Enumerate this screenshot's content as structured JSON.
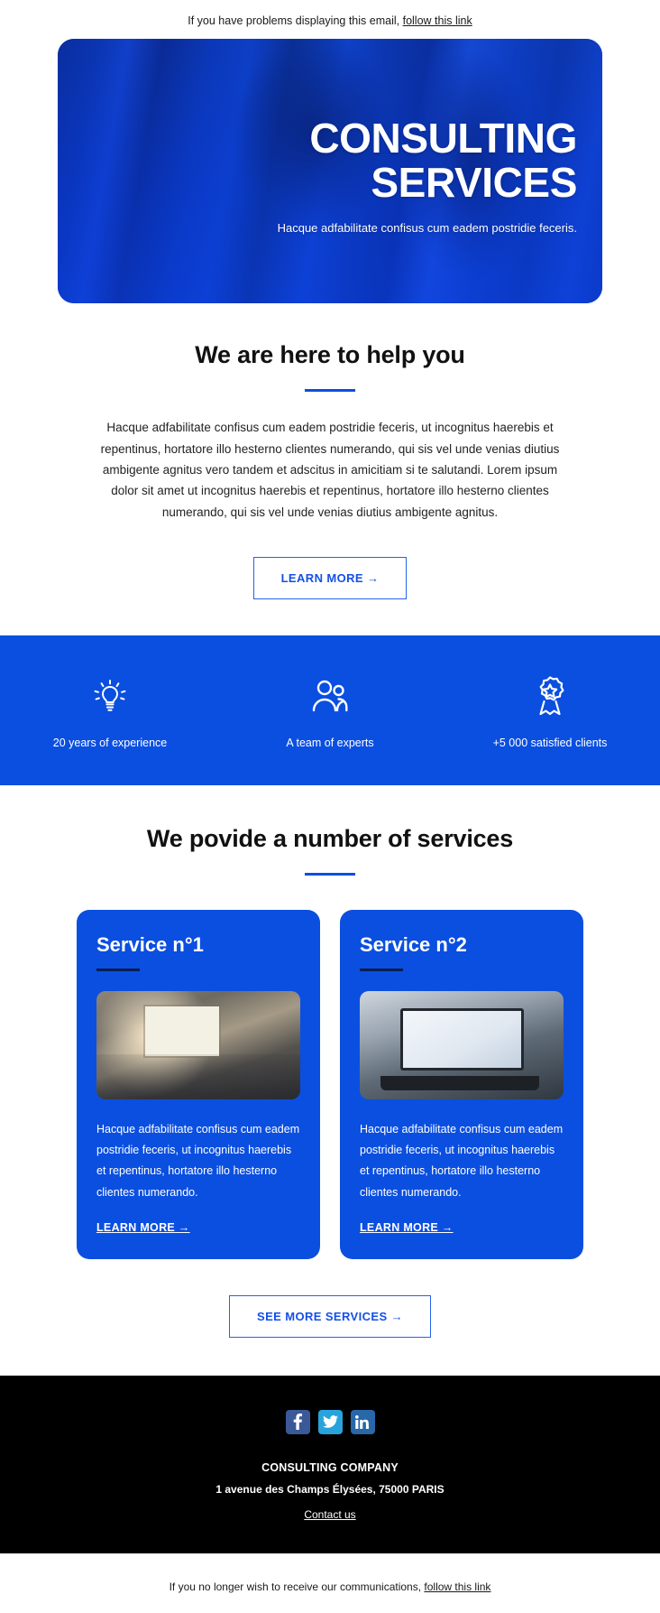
{
  "preheader": {
    "text": "If you have problems displaying this email,",
    "link": "follow this link"
  },
  "hero": {
    "title_line1": "CONSULTING",
    "title_line2": "SERVICES",
    "subtitle": "Hacque adfabilitate confisus cum eadem postridie feceris."
  },
  "intro": {
    "heading": "We are here to help you",
    "body": "Hacque adfabilitate confisus cum eadem postridie feceris, ut incognitus haerebis et repentinus, hortatore illo hesterno clientes numerando, qui sis vel unde venias diutius ambigente agnitus vero tandem et adscitus in amicitiam si te salutandi. Lorem ipsum dolor sit amet ut incognitus haerebis et repentinus, hortatore illo hesterno clientes numerando, qui sis vel unde venias diutius ambigente agnitus.",
    "cta": "LEARN MORE →"
  },
  "features": {
    "background_color": "#0b4fe0",
    "items": [
      {
        "icon": "lightbulb-icon",
        "label": "20 years of experience"
      },
      {
        "icon": "team-icon",
        "label": "A team of experts"
      },
      {
        "icon": "award-ribbon-icon",
        "label": "+5 000 satisfied clients"
      }
    ]
  },
  "services": {
    "heading": "We povide a number of services",
    "cards": [
      {
        "title": "Service n°1",
        "body": "Hacque adfabilitate confisus cum eadem postridie feceris, ut incognitus haerebis et repentinus, hortatore illo hesterno clientes numerando.",
        "link": "LEARN MORE →"
      },
      {
        "title": "Service n°2",
        "body": "Hacque adfabilitate confisus cum eadem postridie feceris, ut incognitus haerebis et repentinus, hortatore illo hesterno clientes numerando.",
        "link": "LEARN MORE →"
      }
    ],
    "cta": "SEE MORE SERVICES →"
  },
  "footer": {
    "socials": [
      {
        "name": "facebook",
        "glyph": "f",
        "color": "#3b5998"
      },
      {
        "name": "twitter",
        "glyph": "",
        "color": "#29a3dc"
      },
      {
        "name": "linkedin",
        "glyph": "in",
        "color": "#2867a8"
      }
    ],
    "company": "CONSULTING COMPANY",
    "address": "1 avenue des Champs Élysées, 75000 PARIS",
    "contact": "Contact us"
  },
  "unsubscribe": {
    "text": "If you no longer wish to receive our communications,",
    "link": "follow this link"
  },
  "colors": {
    "brand_blue": "#0b4fe0",
    "footer_black": "#000000",
    "text_dark": "#111111"
  }
}
